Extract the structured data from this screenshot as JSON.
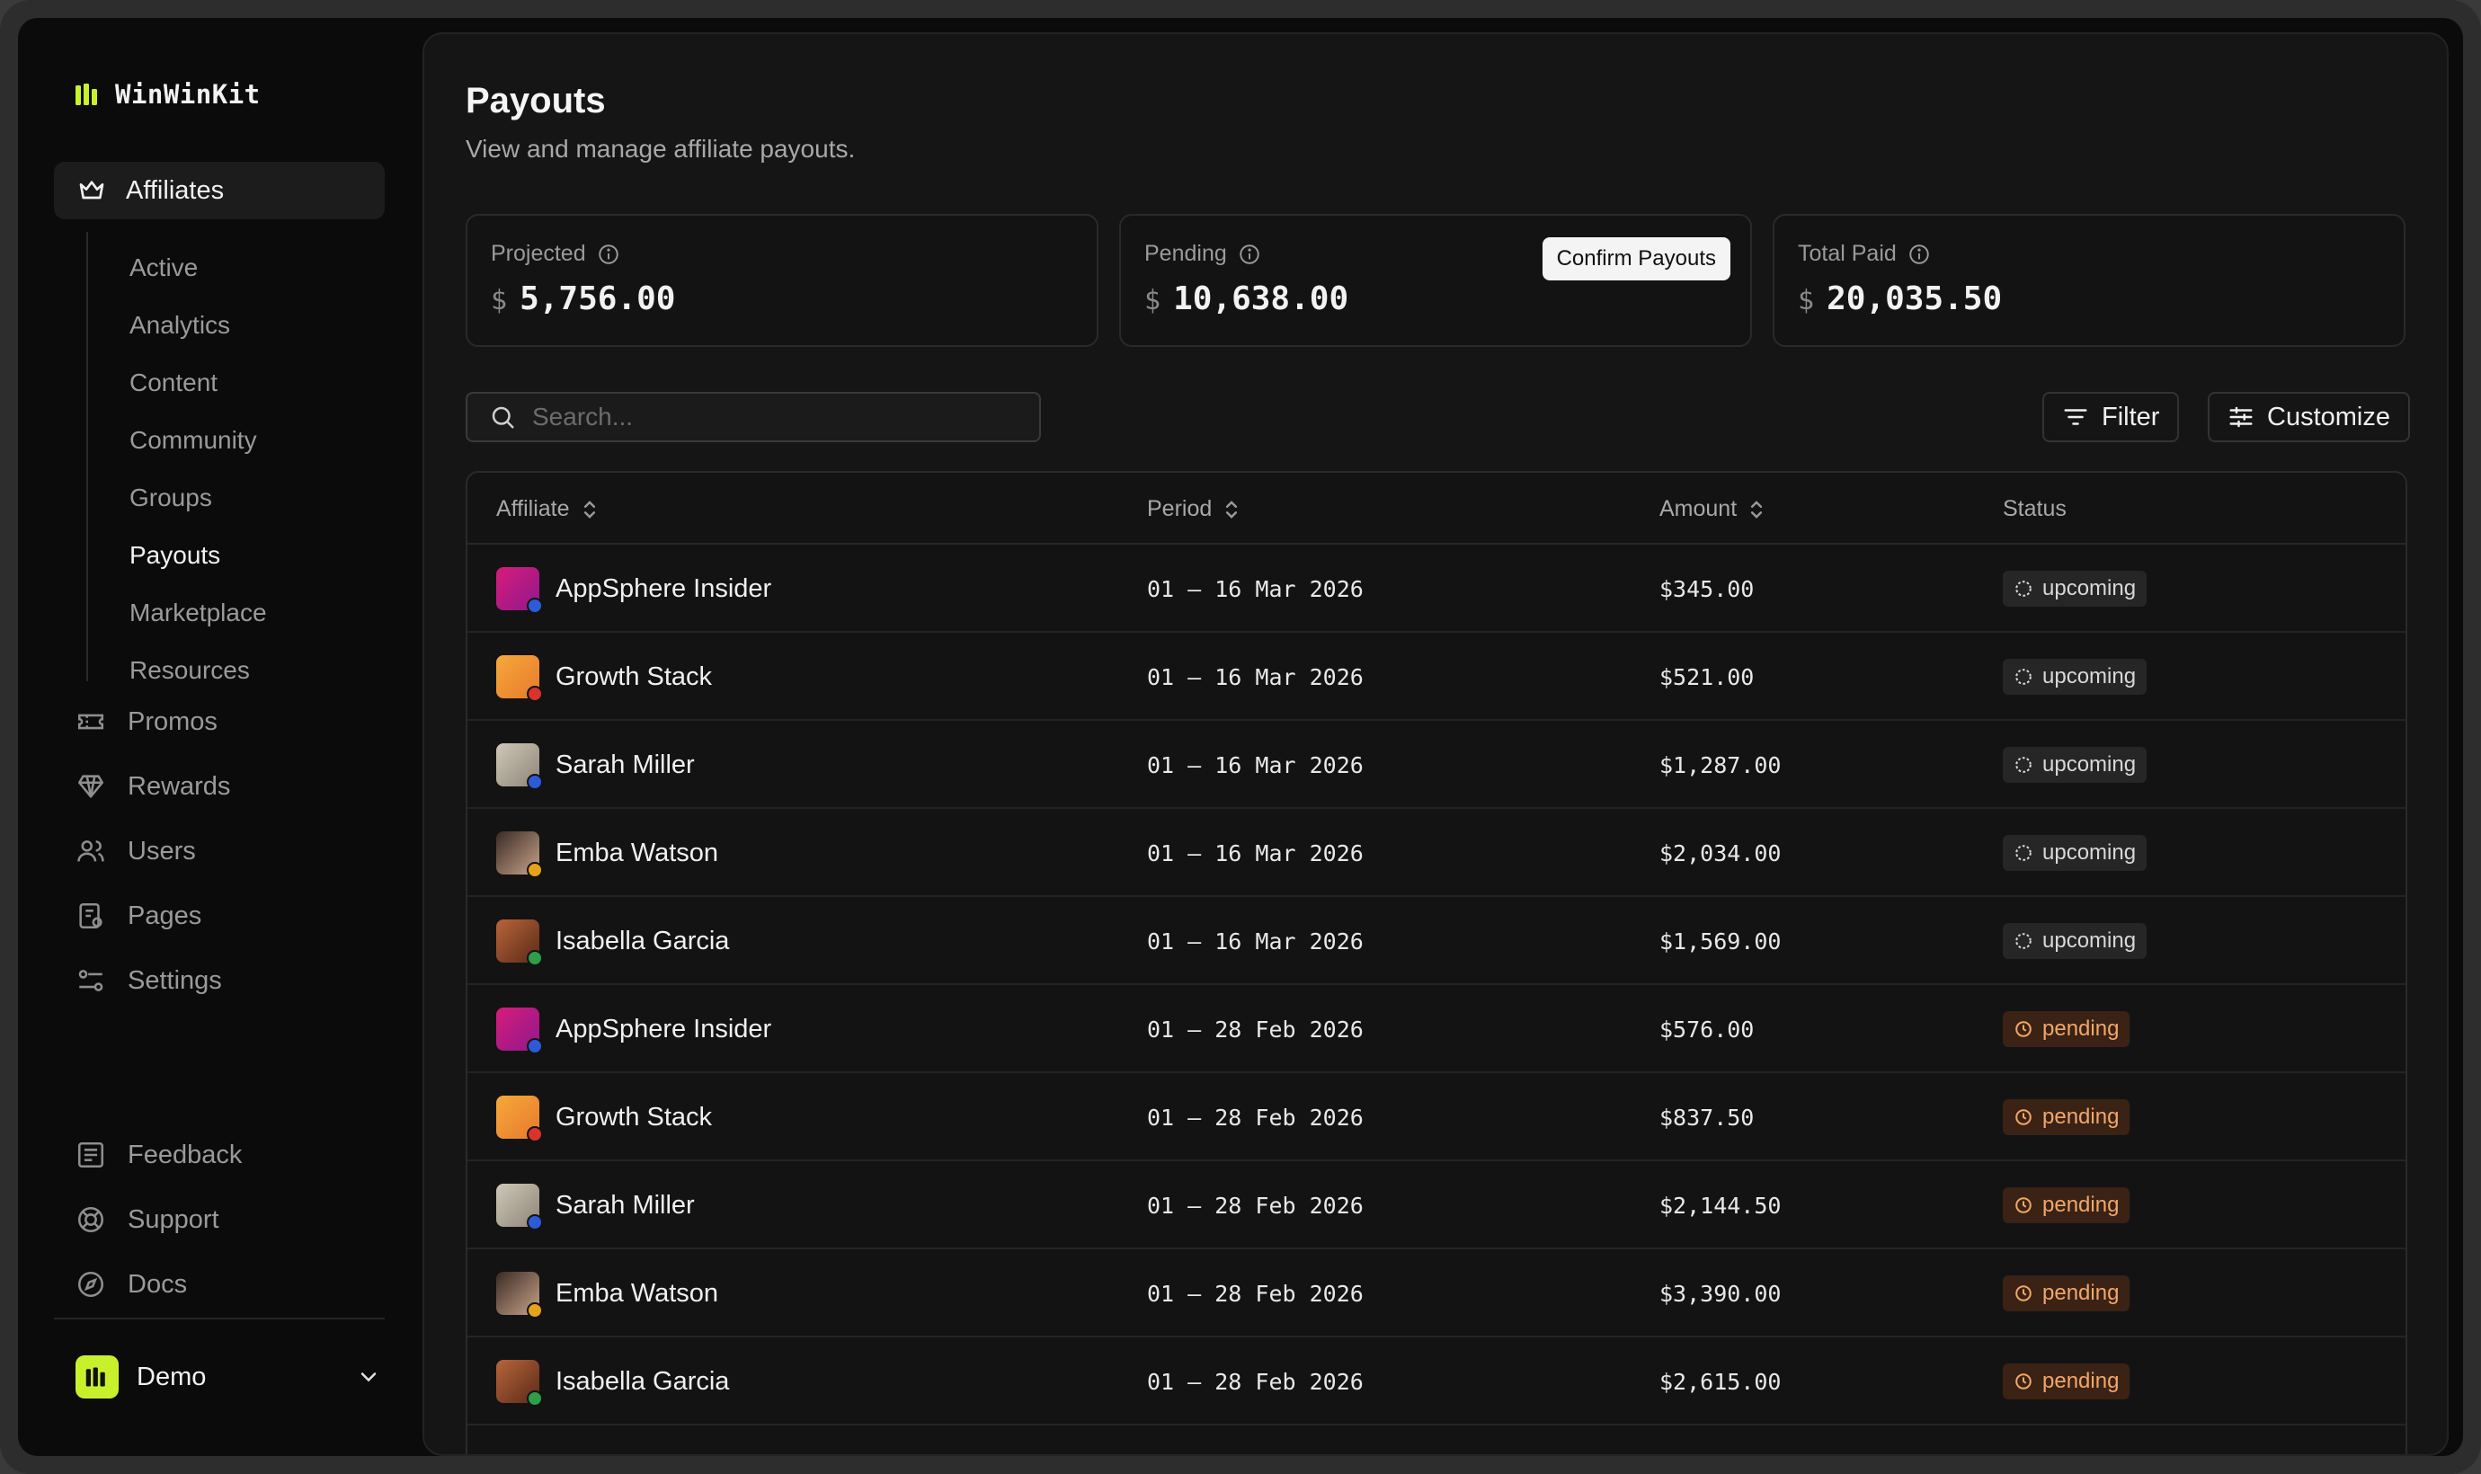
{
  "brand": {
    "name": "WinWinKit"
  },
  "sidebar": {
    "section": {
      "label": "Affiliates",
      "icon": "crown-icon"
    },
    "subitems": [
      {
        "label": "Active",
        "active": false
      },
      {
        "label": "Analytics",
        "active": false
      },
      {
        "label": "Content",
        "active": false
      },
      {
        "label": "Community",
        "active": false
      },
      {
        "label": "Groups",
        "active": false
      },
      {
        "label": "Payouts",
        "active": true
      },
      {
        "label": "Marketplace",
        "active": false
      },
      {
        "label": "Resources",
        "active": false
      }
    ],
    "items": [
      {
        "label": "Promos",
        "icon": "ticket-icon"
      },
      {
        "label": "Rewards",
        "icon": "gem-icon"
      },
      {
        "label": "Users",
        "icon": "users-icon"
      },
      {
        "label": "Pages",
        "icon": "pages-icon"
      },
      {
        "label": "Settings",
        "icon": "settings-icon"
      }
    ],
    "footer_items": [
      {
        "label": "Feedback",
        "icon": "feedback-icon"
      },
      {
        "label": "Support",
        "icon": "lifebuoy-icon"
      },
      {
        "label": "Docs",
        "icon": "compass-icon"
      }
    ],
    "workspace": {
      "name": "Demo"
    }
  },
  "page": {
    "title": "Payouts",
    "subtitle": "View and manage affiliate payouts."
  },
  "cards": {
    "projected": {
      "label": "Projected",
      "currency": "$",
      "value": "5,756.00"
    },
    "pending": {
      "label": "Pending",
      "currency": "$",
      "value": "10,638.00",
      "action": "Confirm Payouts"
    },
    "total_paid": {
      "label": "Total Paid",
      "currency": "$",
      "value": "20,035.50"
    }
  },
  "toolbar": {
    "search_placeholder": "Search...",
    "filter_label": "Filter",
    "customize_label": "Customize"
  },
  "table": {
    "columns": [
      "Affiliate",
      "Period",
      "Amount",
      "Status"
    ],
    "rows": [
      {
        "affiliate": "AppSphere Insider",
        "period": "01 – 16 Mar 2026",
        "amount": "$345.00",
        "status": "upcoming"
      },
      {
        "affiliate": "Growth Stack",
        "period": "01 – 16 Mar 2026",
        "amount": "$521.00",
        "status": "upcoming"
      },
      {
        "affiliate": "Sarah Miller",
        "period": "01 – 16 Mar 2026",
        "amount": "$1,287.00",
        "status": "upcoming"
      },
      {
        "affiliate": "Emba Watson",
        "period": "01 – 16 Mar 2026",
        "amount": "$2,034.00",
        "status": "upcoming"
      },
      {
        "affiliate": "Isabella Garcia",
        "period": "01 – 16 Mar 2026",
        "amount": "$1,569.00",
        "status": "upcoming"
      },
      {
        "affiliate": "AppSphere Insider",
        "period": "01 – 28 Feb 2026",
        "amount": "$576.00",
        "status": "pending"
      },
      {
        "affiliate": "Growth Stack",
        "period": "01 – 28 Feb 2026",
        "amount": "$837.50",
        "status": "pending"
      },
      {
        "affiliate": "Sarah Miller",
        "period": "01 – 28 Feb 2026",
        "amount": "$2,144.50",
        "status": "pending"
      },
      {
        "affiliate": "Emba Watson",
        "period": "01 – 28 Feb 2026",
        "amount": "$3,390.00",
        "status": "pending"
      },
      {
        "affiliate": "Isabella Garcia",
        "period": "01 – 28 Feb 2026",
        "amount": "$2,615.00",
        "status": "pending"
      }
    ]
  },
  "colors": {
    "brand_accent": "#c8f12c",
    "pending_badge_bg": "#3a2214",
    "pending_badge_text": "#f0a76a",
    "upcoming_badge_bg": "#262626"
  }
}
